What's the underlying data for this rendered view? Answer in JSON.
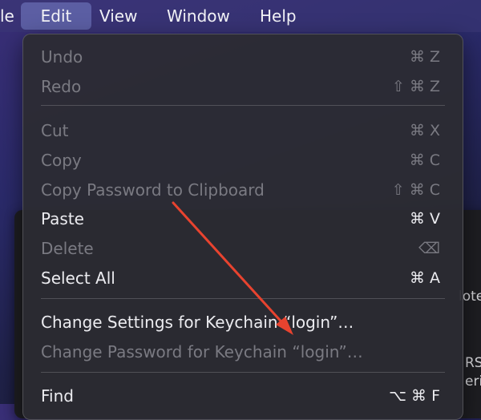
{
  "menubar": {
    "items": [
      {
        "label": "le"
      },
      {
        "label": "Edit",
        "active": true
      },
      {
        "label": "View"
      },
      {
        "label": "Window"
      },
      {
        "label": "Help"
      }
    ]
  },
  "background_window": {
    "fragments": [
      "lote",
      "RSA",
      "eriv"
    ]
  },
  "edit_menu": {
    "items": [
      {
        "label": "Undo",
        "shortcut": "⌘ Z",
        "enabled": false
      },
      {
        "label": "Redo",
        "shortcut": "⇧ ⌘ Z",
        "enabled": false
      },
      {
        "label": "Cut",
        "shortcut": "⌘ X",
        "enabled": false
      },
      {
        "label": "Copy",
        "shortcut": "⌘ C",
        "enabled": false
      },
      {
        "label": "Copy Password to Clipboard",
        "shortcut": "⇧ ⌘ C",
        "enabled": false
      },
      {
        "label": "Paste",
        "shortcut": "⌘ V",
        "enabled": true
      },
      {
        "label": "Delete",
        "shortcut": "⌫",
        "enabled": false
      },
      {
        "label": "Select All",
        "shortcut": "⌘ A",
        "enabled": true
      },
      {
        "label": "Change Settings for Keychain “login”…",
        "shortcut": "",
        "enabled": true
      },
      {
        "label": "Change Password for Keychain “login”…",
        "shortcut": "",
        "enabled": false
      },
      {
        "label": "Find",
        "shortcut": "⌥ ⌘ F",
        "enabled": true
      }
    ]
  },
  "colors": {
    "annotation_arrow": "#e8432f",
    "menu_background": "#2c2c32",
    "enabled_text": "#ececf0",
    "disabled_text": "#7a7a82"
  }
}
